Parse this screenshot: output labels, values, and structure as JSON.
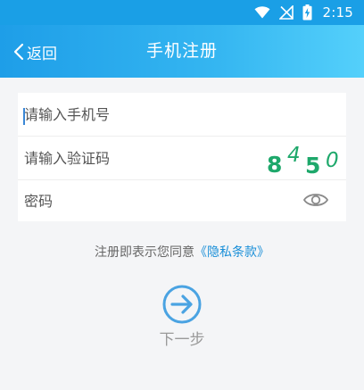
{
  "status_bar": {
    "time": "2:15",
    "icons": [
      "wifi-icon",
      "no-signal-icon",
      "battery-charging-icon"
    ]
  },
  "toolbar": {
    "back_label": "返回",
    "title": "手机注册",
    "back_icon": "chevron-left-icon"
  },
  "form": {
    "phone": {
      "placeholder": "请输入手机号",
      "value": ""
    },
    "code": {
      "placeholder": "请输入验证码",
      "value": ""
    },
    "captcha": {
      "chars": [
        "8",
        "4",
        "5",
        "0"
      ],
      "color": "#1ea86b"
    },
    "password": {
      "placeholder": "密码",
      "value": "",
      "toggle_icon": "eye-icon"
    }
  },
  "agreement": {
    "text": "注册即表示您同意",
    "link": "《隐私条款》",
    "link_color": "#1a8fd8"
  },
  "next": {
    "label": "下一步",
    "icon": "arrow-right-circle-icon",
    "color": "#4aa3e2"
  },
  "colors": {
    "status_bar": "#1a9fe6",
    "toolbar_gradient": [
      "#1e9ee8",
      "#54d0fb"
    ],
    "background": "#f4f5f7"
  }
}
